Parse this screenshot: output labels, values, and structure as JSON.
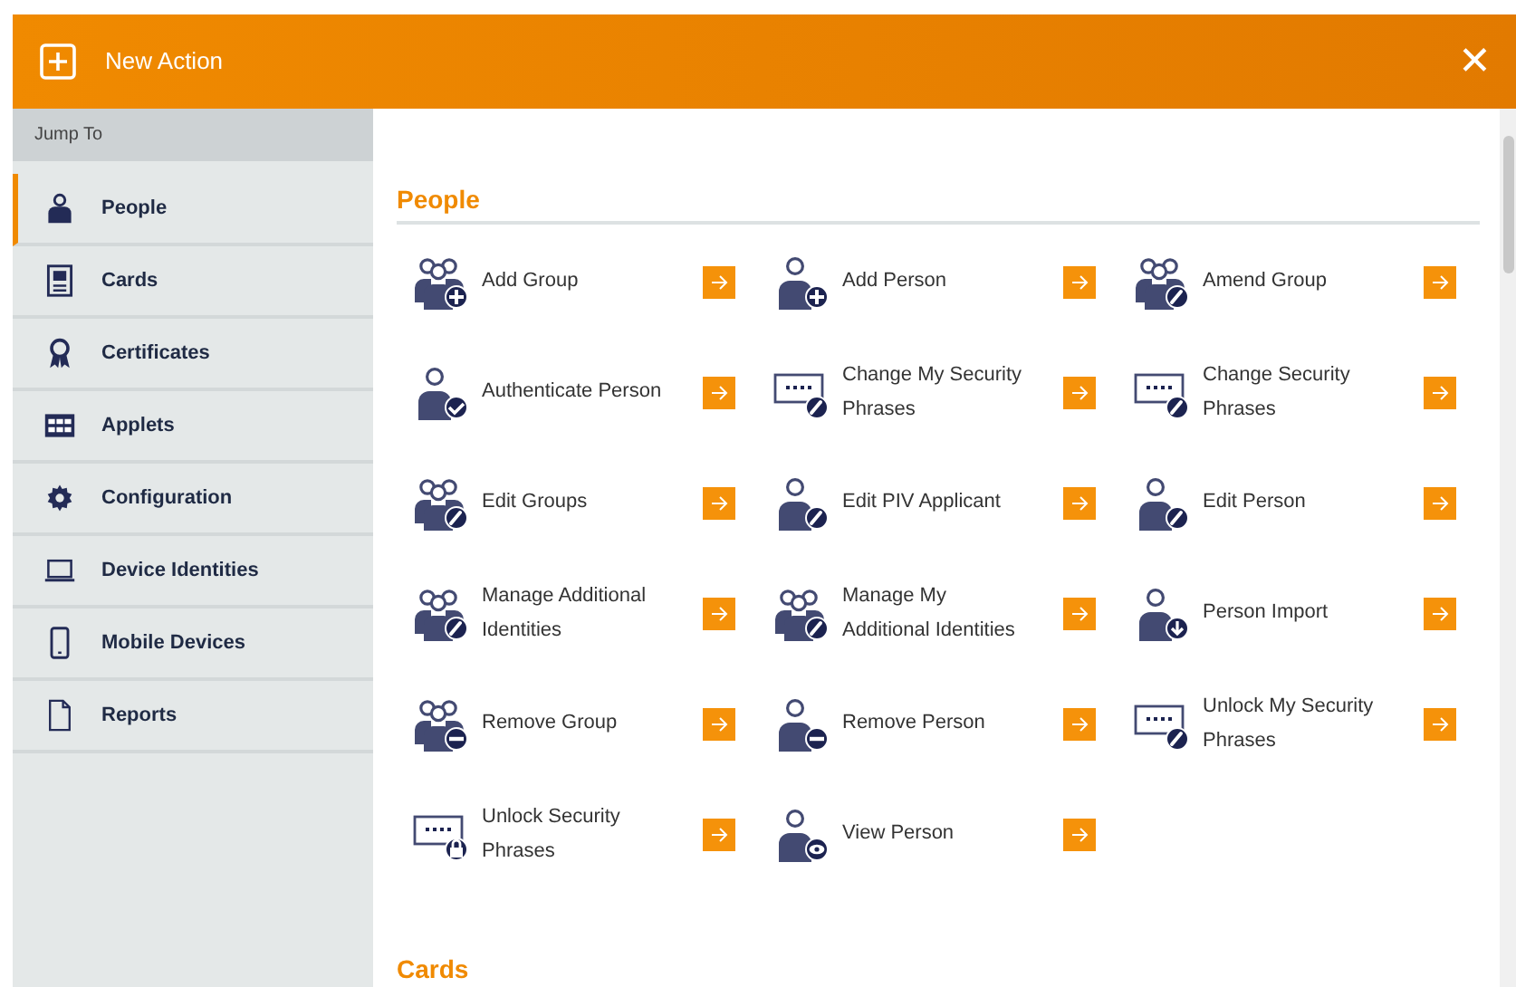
{
  "header": {
    "title": "New Action",
    "close": "✕"
  },
  "sidebar": {
    "heading": "Jump To",
    "items": [
      {
        "label": "People",
        "selected": true
      },
      {
        "label": "Cards",
        "selected": false
      },
      {
        "label": "Certificates",
        "selected": false
      },
      {
        "label": "Applets",
        "selected": false
      },
      {
        "label": "Configuration",
        "selected": false
      },
      {
        "label": "Device Identities",
        "selected": false
      },
      {
        "label": "Mobile Devices",
        "selected": false
      },
      {
        "label": "Reports",
        "selected": false
      }
    ]
  },
  "sections": [
    {
      "title": "People",
      "actions": [
        {
          "label": "Add Group"
        },
        {
          "label": "Add Person"
        },
        {
          "label": "Amend Group"
        },
        {
          "label": "Authenticate Person"
        },
        {
          "label": "Change My Security Phrases"
        },
        {
          "label": "Change Security Phrases"
        },
        {
          "label": "Edit Groups"
        },
        {
          "label": "Edit PIV Applicant"
        },
        {
          "label": "Edit Person"
        },
        {
          "label": "Manage Additional Identities"
        },
        {
          "label": "Manage My Additional Identities"
        },
        {
          "label": "Person Import"
        },
        {
          "label": "Remove Group"
        },
        {
          "label": "Remove Person"
        },
        {
          "label": "Unlock My Security Phrases"
        },
        {
          "label": "Unlock Security Phrases"
        },
        {
          "label": "View Person"
        }
      ]
    },
    {
      "title": "Cards"
    }
  ]
}
